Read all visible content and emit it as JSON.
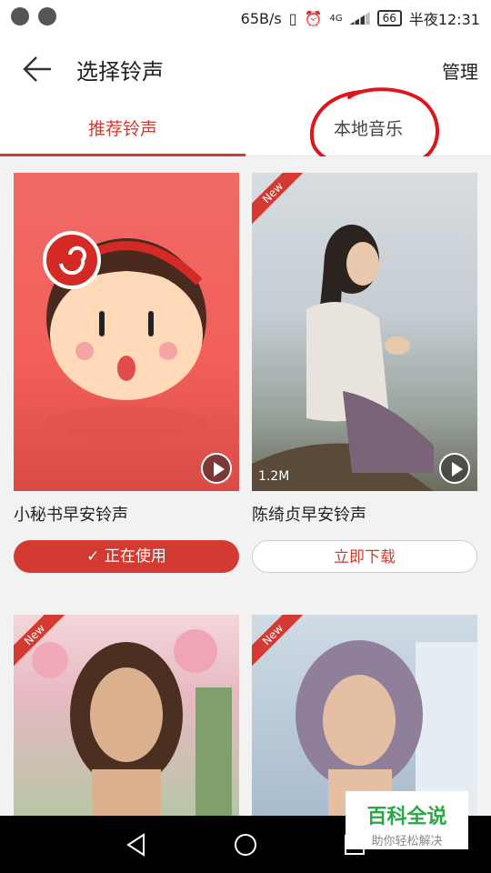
{
  "status_bar": {
    "speed": "65B/s",
    "network": "4G",
    "battery": "66",
    "time": "半夜12:31"
  },
  "header": {
    "title": "选择铃声",
    "manage_label": "管理"
  },
  "tabs": [
    {
      "label": "推荐铃声",
      "active": true
    },
    {
      "label": "本地音乐",
      "active": false
    }
  ],
  "cards": [
    {
      "name": "小秘书早安铃声",
      "size": "",
      "badge": "",
      "button": "正在使用",
      "button_state": "using"
    },
    {
      "name": "陈绮贞早安铃声",
      "size": "1.2M",
      "badge": "New",
      "button": "立即下载",
      "button_state": "download"
    },
    {
      "name": "",
      "size": "",
      "badge": "New",
      "button": "",
      "button_state": ""
    },
    {
      "name": "",
      "size": "",
      "badge": "New",
      "button": "",
      "button_state": ""
    }
  ],
  "watermark": {
    "title": "百科全说",
    "subtitle": "助你轻松解决"
  },
  "colors": {
    "accent": "#d33a31",
    "annotation": "#e0141b"
  }
}
